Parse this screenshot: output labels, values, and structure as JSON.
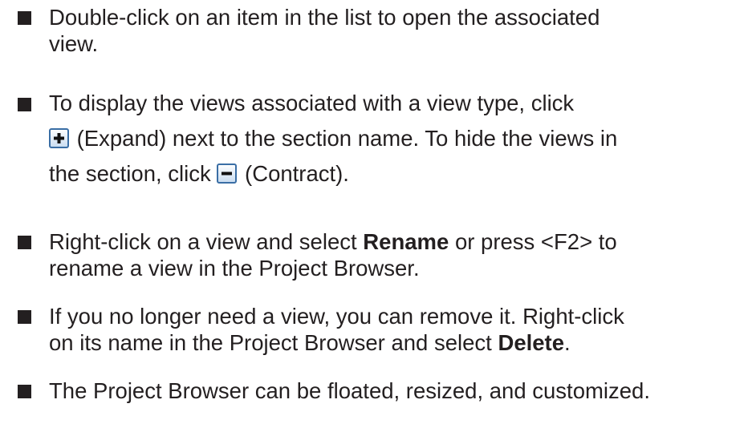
{
  "items": [
    {
      "line1": "Double-click on an item in the list to open the associated",
      "line2": "view."
    },
    {
      "line1": "To display the views associated with a view type, click",
      "expand_label": "(Expand) next to the section name. To hide the views in",
      "line3_prefix": "the section, click",
      "contract_label": "(Contract)."
    },
    {
      "prefix": "Right-click on a view and select",
      "bold": "Rename",
      "suffix": "or press <F2> to",
      "line2": "rename a view in the Project Browser."
    },
    {
      "line1": "If you no longer need a view, you can remove it. Right-click",
      "prefix": "on its name in the Project Browser and select",
      "bold": "Delete",
      "suffix": "."
    },
    {
      "line1": "The Project Browser can be floated, resized, and customized."
    }
  ],
  "icons": {
    "expand": "expand-plus-icon",
    "contract": "contract-minus-icon",
    "icon_border": "#3a6ea5",
    "icon_fill_top": "#ffffff",
    "icon_fill_bottom": "#c8dcf0",
    "icon_glyph": "#111111"
  }
}
